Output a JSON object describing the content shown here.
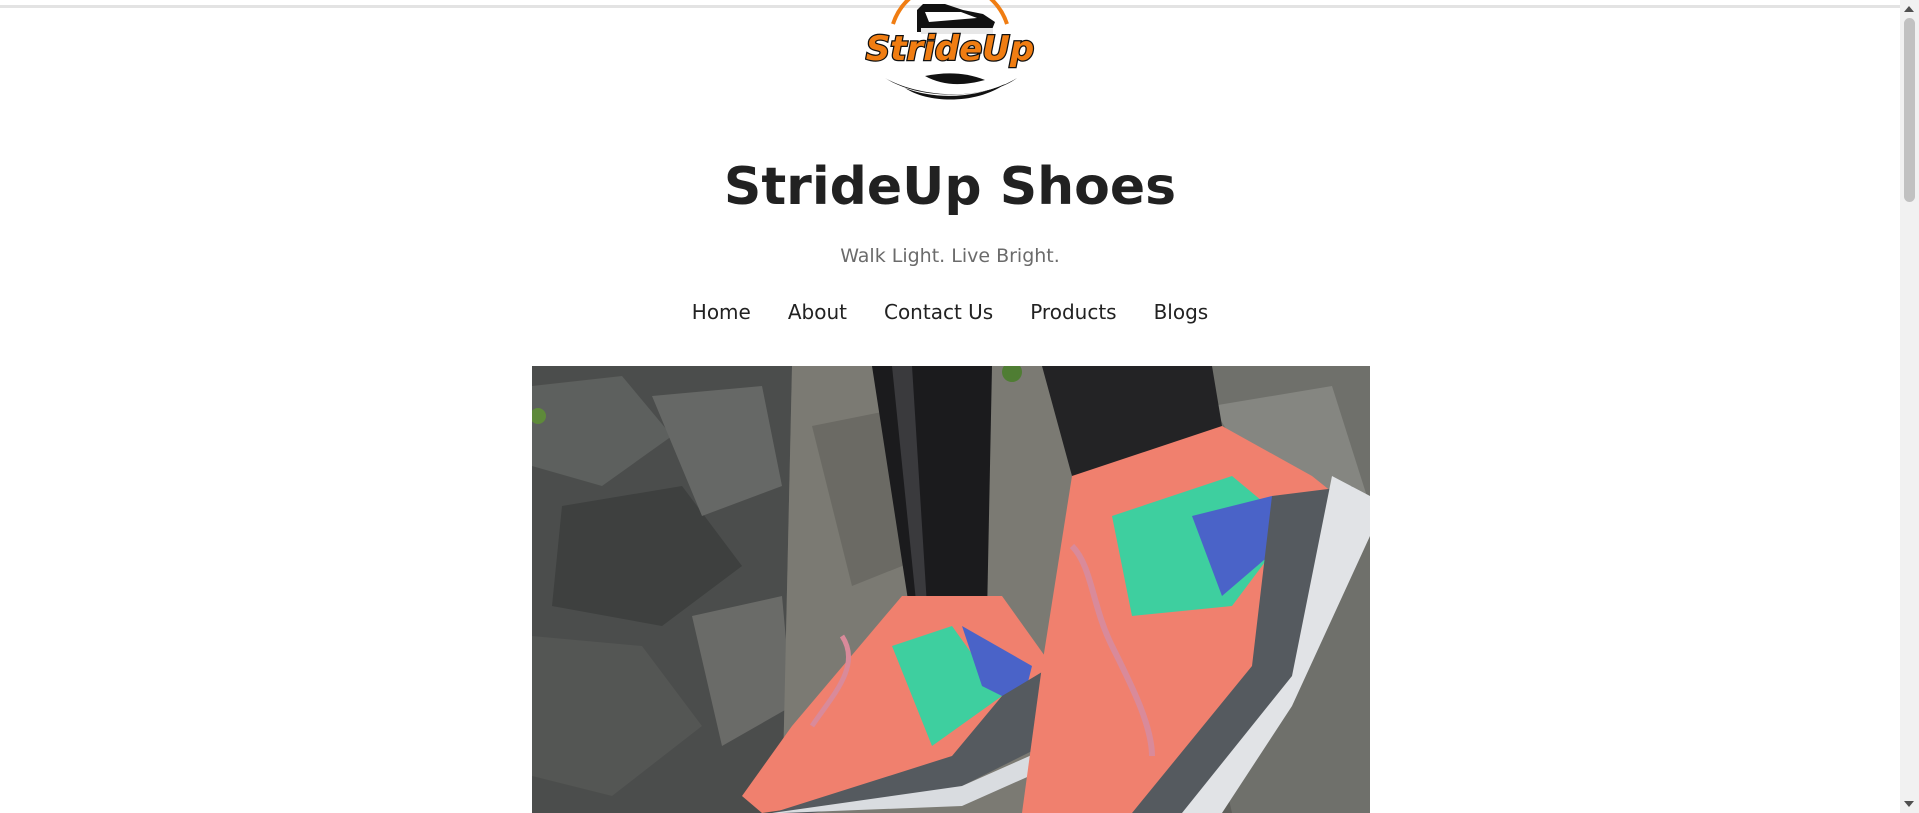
{
  "logo": {
    "text": "StrideUp",
    "accent_color": "#f07d12"
  },
  "header": {
    "title": "StrideUp Shoes",
    "tagline": "Walk Light. Live Bright."
  },
  "nav": {
    "items": [
      {
        "label": "Home"
      },
      {
        "label": "About"
      },
      {
        "label": "Contact Us"
      },
      {
        "label": "Products"
      },
      {
        "label": "Blogs"
      }
    ]
  },
  "hero": {
    "shoe_colors": [
      "#f0806e",
      "#3ecf9f",
      "#4a63c8",
      "#555a5f"
    ]
  }
}
